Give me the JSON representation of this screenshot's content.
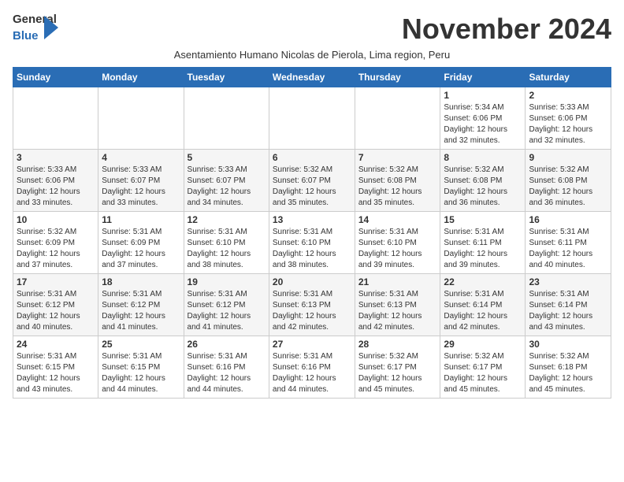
{
  "header": {
    "logo_general": "General",
    "logo_blue": "Blue",
    "month_title": "November 2024",
    "subtitle": "Asentamiento Humano Nicolas de Pierola, Lima region, Peru"
  },
  "days_of_week": [
    "Sunday",
    "Monday",
    "Tuesday",
    "Wednesday",
    "Thursday",
    "Friday",
    "Saturday"
  ],
  "weeks": [
    [
      {
        "day": "",
        "data": ""
      },
      {
        "day": "",
        "data": ""
      },
      {
        "day": "",
        "data": ""
      },
      {
        "day": "",
        "data": ""
      },
      {
        "day": "",
        "data": ""
      },
      {
        "day": "1",
        "data": "Sunrise: 5:34 AM\nSunset: 6:06 PM\nDaylight: 12 hours and 32 minutes."
      },
      {
        "day": "2",
        "data": "Sunrise: 5:33 AM\nSunset: 6:06 PM\nDaylight: 12 hours and 32 minutes."
      }
    ],
    [
      {
        "day": "3",
        "data": "Sunrise: 5:33 AM\nSunset: 6:06 PM\nDaylight: 12 hours and 33 minutes."
      },
      {
        "day": "4",
        "data": "Sunrise: 5:33 AM\nSunset: 6:07 PM\nDaylight: 12 hours and 33 minutes."
      },
      {
        "day": "5",
        "data": "Sunrise: 5:33 AM\nSunset: 6:07 PM\nDaylight: 12 hours and 34 minutes."
      },
      {
        "day": "6",
        "data": "Sunrise: 5:32 AM\nSunset: 6:07 PM\nDaylight: 12 hours and 35 minutes."
      },
      {
        "day": "7",
        "data": "Sunrise: 5:32 AM\nSunset: 6:08 PM\nDaylight: 12 hours and 35 minutes."
      },
      {
        "day": "8",
        "data": "Sunrise: 5:32 AM\nSunset: 6:08 PM\nDaylight: 12 hours and 36 minutes."
      },
      {
        "day": "9",
        "data": "Sunrise: 5:32 AM\nSunset: 6:08 PM\nDaylight: 12 hours and 36 minutes."
      }
    ],
    [
      {
        "day": "10",
        "data": "Sunrise: 5:32 AM\nSunset: 6:09 PM\nDaylight: 12 hours and 37 minutes."
      },
      {
        "day": "11",
        "data": "Sunrise: 5:31 AM\nSunset: 6:09 PM\nDaylight: 12 hours and 37 minutes."
      },
      {
        "day": "12",
        "data": "Sunrise: 5:31 AM\nSunset: 6:10 PM\nDaylight: 12 hours and 38 minutes."
      },
      {
        "day": "13",
        "data": "Sunrise: 5:31 AM\nSunset: 6:10 PM\nDaylight: 12 hours and 38 minutes."
      },
      {
        "day": "14",
        "data": "Sunrise: 5:31 AM\nSunset: 6:10 PM\nDaylight: 12 hours and 39 minutes."
      },
      {
        "day": "15",
        "data": "Sunrise: 5:31 AM\nSunset: 6:11 PM\nDaylight: 12 hours and 39 minutes."
      },
      {
        "day": "16",
        "data": "Sunrise: 5:31 AM\nSunset: 6:11 PM\nDaylight: 12 hours and 40 minutes."
      }
    ],
    [
      {
        "day": "17",
        "data": "Sunrise: 5:31 AM\nSunset: 6:12 PM\nDaylight: 12 hours and 40 minutes."
      },
      {
        "day": "18",
        "data": "Sunrise: 5:31 AM\nSunset: 6:12 PM\nDaylight: 12 hours and 41 minutes."
      },
      {
        "day": "19",
        "data": "Sunrise: 5:31 AM\nSunset: 6:12 PM\nDaylight: 12 hours and 41 minutes."
      },
      {
        "day": "20",
        "data": "Sunrise: 5:31 AM\nSunset: 6:13 PM\nDaylight: 12 hours and 42 minutes."
      },
      {
        "day": "21",
        "data": "Sunrise: 5:31 AM\nSunset: 6:13 PM\nDaylight: 12 hours and 42 minutes."
      },
      {
        "day": "22",
        "data": "Sunrise: 5:31 AM\nSunset: 6:14 PM\nDaylight: 12 hours and 42 minutes."
      },
      {
        "day": "23",
        "data": "Sunrise: 5:31 AM\nSunset: 6:14 PM\nDaylight: 12 hours and 43 minutes."
      }
    ],
    [
      {
        "day": "24",
        "data": "Sunrise: 5:31 AM\nSunset: 6:15 PM\nDaylight: 12 hours and 43 minutes."
      },
      {
        "day": "25",
        "data": "Sunrise: 5:31 AM\nSunset: 6:15 PM\nDaylight: 12 hours and 44 minutes."
      },
      {
        "day": "26",
        "data": "Sunrise: 5:31 AM\nSunset: 6:16 PM\nDaylight: 12 hours and 44 minutes."
      },
      {
        "day": "27",
        "data": "Sunrise: 5:31 AM\nSunset: 6:16 PM\nDaylight: 12 hours and 44 minutes."
      },
      {
        "day": "28",
        "data": "Sunrise: 5:32 AM\nSunset: 6:17 PM\nDaylight: 12 hours and 45 minutes."
      },
      {
        "day": "29",
        "data": "Sunrise: 5:32 AM\nSunset: 6:17 PM\nDaylight: 12 hours and 45 minutes."
      },
      {
        "day": "30",
        "data": "Sunrise: 5:32 AM\nSunset: 6:18 PM\nDaylight: 12 hours and 45 minutes."
      }
    ]
  ]
}
